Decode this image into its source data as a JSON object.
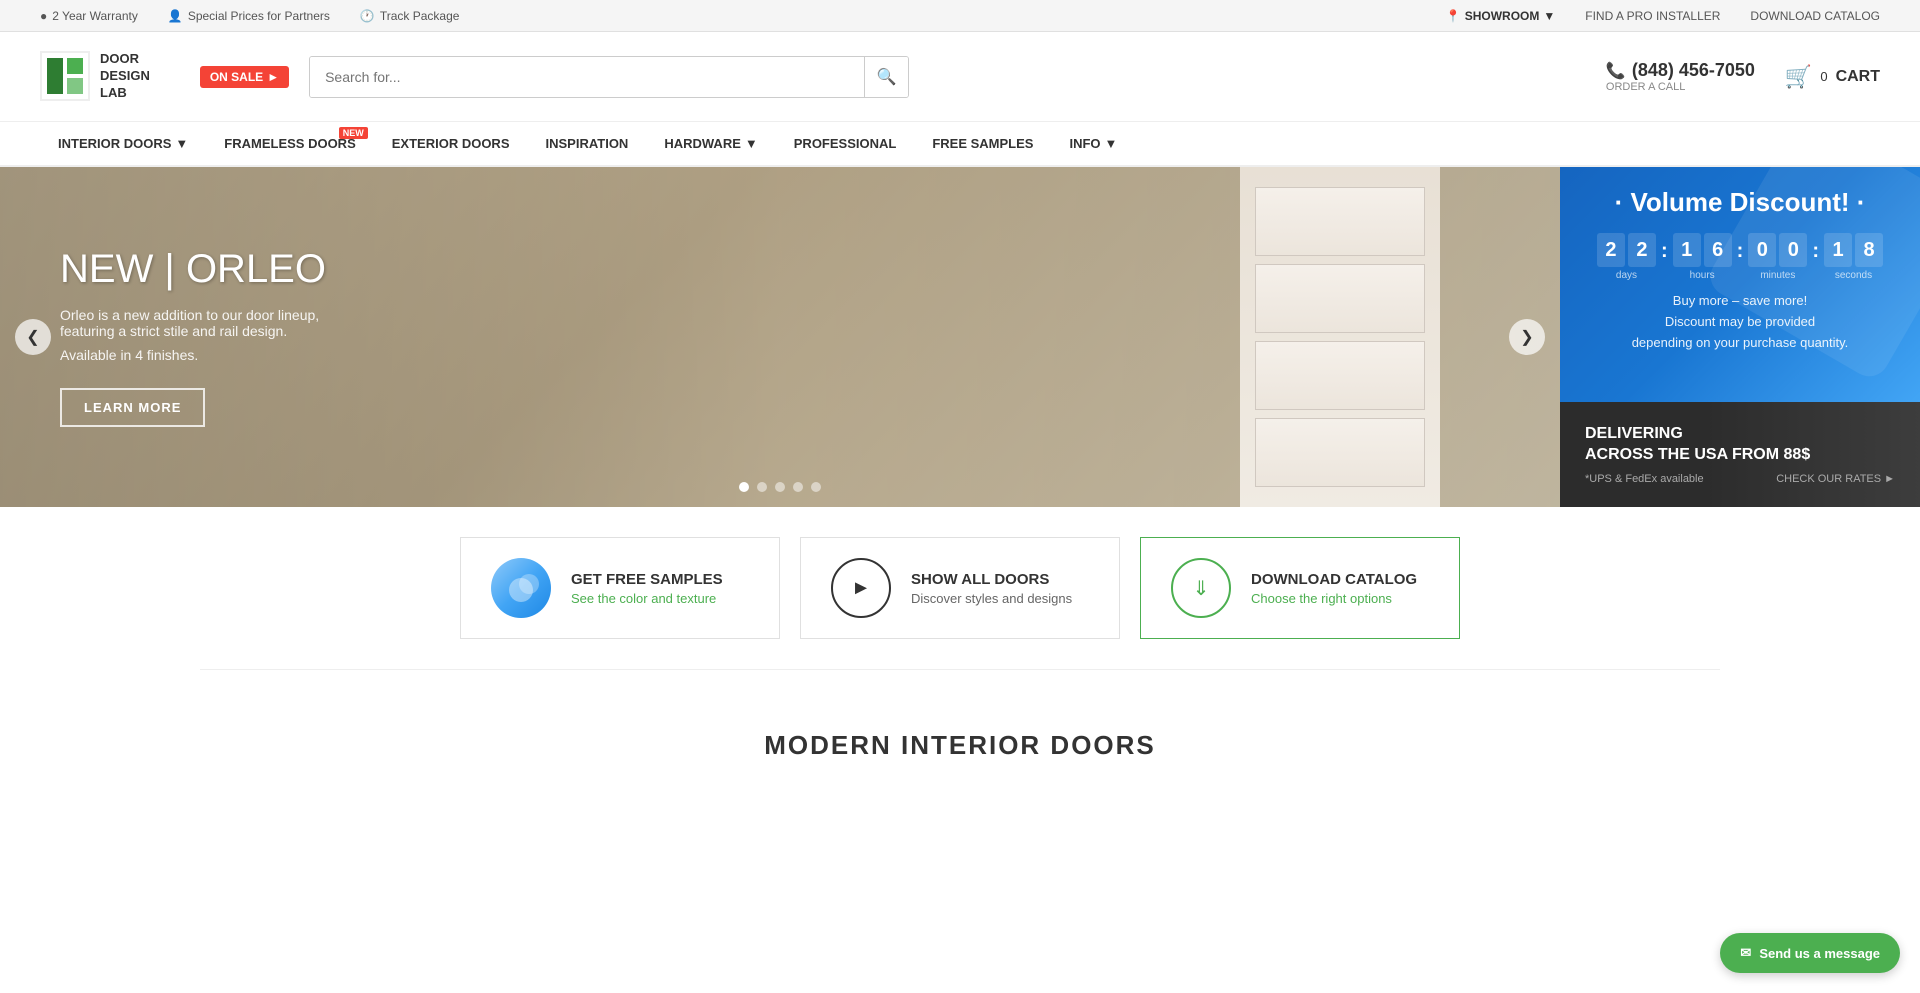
{
  "topbar": {
    "warranty": "2 Year Warranty",
    "partners": "Special Prices for Partners",
    "track": "Track Package",
    "showroom": "SHOWROOM",
    "find_pro": "FIND A PRO INSTALLER",
    "download_catalog": "DOWNLOAD CATALOG"
  },
  "header": {
    "logo_letters": "D",
    "logo_text_line1": "DOOR",
    "logo_text_line2": "DESIGN",
    "logo_text_line3": "LAB",
    "on_sale": "ON SALE",
    "search_placeholder": "Search for...",
    "phone": "(848) 456-7050",
    "order_call": "ORDER A CALL",
    "cart_count": "0",
    "cart_label": "CART"
  },
  "nav": {
    "items": [
      {
        "label": "INTERIOR DOORS",
        "has_dropdown": true
      },
      {
        "label": "FRAMELESS DOORS",
        "is_new": true,
        "has_dropdown": false
      },
      {
        "label": "EXTERIOR DOORS",
        "has_dropdown": false
      },
      {
        "label": "INSPIRATION",
        "has_dropdown": false
      },
      {
        "label": "HARDWARE",
        "has_dropdown": true
      },
      {
        "label": "PROFESSIONAL",
        "has_dropdown": false
      },
      {
        "label": "FREE SAMPLES",
        "has_dropdown": false
      },
      {
        "label": "INFO",
        "has_dropdown": true
      }
    ]
  },
  "hero": {
    "title": "NEW | ORLEO",
    "subtitle_line1": "Orleo is a new addition to our door lineup,",
    "subtitle_line2": "featuring a strict stile and rail design.",
    "available": "Available in 4 finishes.",
    "learn_more": "LEARN MORE",
    "dots_count": 5,
    "active_dot": 0
  },
  "volume_discount": {
    "title": "· Volume Discount! ·",
    "days": [
      "2",
      "2"
    ],
    "hours": [
      "1",
      "6"
    ],
    "minutes": [
      "0",
      "0"
    ],
    "seconds": [
      "1",
      "8"
    ],
    "label_days": "days",
    "label_hours": "hours",
    "label_minutes": "minutes",
    "label_seconds": "seconds",
    "desc_line1": "Buy more – save more!",
    "desc_line2": "Discount may be provided",
    "desc_line3": "depending on your purchase quantity."
  },
  "delivery": {
    "title_line1": "DELIVERING",
    "title_line2": "ACROSS THE USA FROM 88$",
    "sub": "*UPS & FedEx available",
    "check_rates": "CHECK OUR RATES"
  },
  "cta": {
    "samples": {
      "title": "GET FREE SAMPLES",
      "subtitle": "See the color and texture"
    },
    "show_all": {
      "title": "SHOW ALL DOORS",
      "subtitle": "Discover styles and designs"
    },
    "catalog": {
      "title": "DOWNLOAD CATALOG",
      "subtitle": "Choose the right options"
    }
  },
  "section": {
    "title": "MODERN INTERIOR DOORS"
  },
  "chat": {
    "label": "Send us a message"
  }
}
